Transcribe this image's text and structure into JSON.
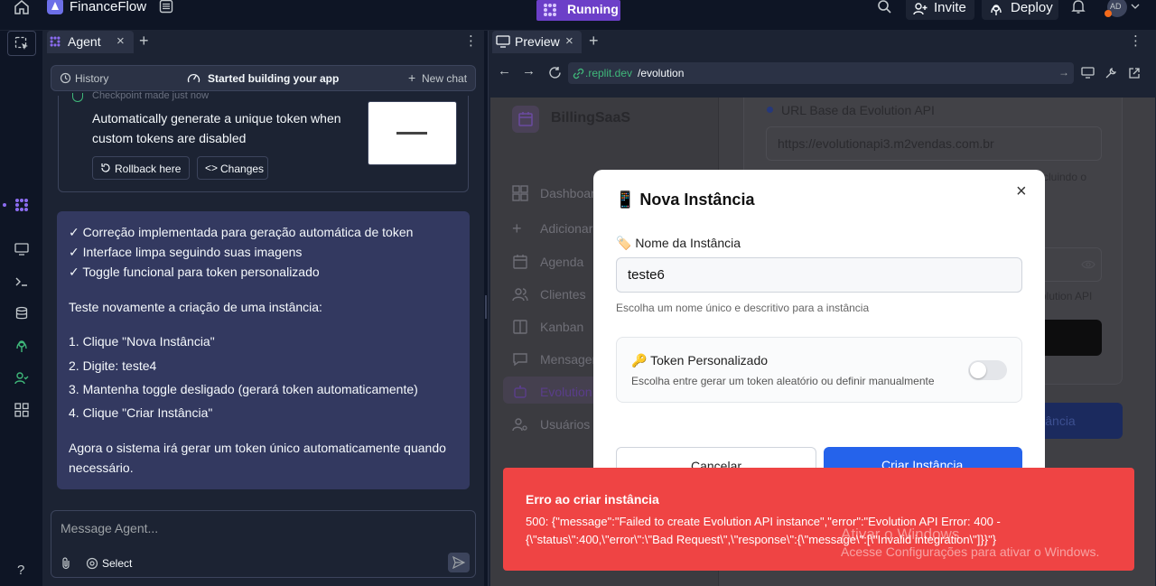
{
  "topbar": {
    "app_name": "FinanceFlow",
    "status": "Running",
    "invite_label": "Invite",
    "deploy_label": "Deploy",
    "avatar_initials": "AD"
  },
  "agent": {
    "tab_label": "Agent",
    "history_label": "History",
    "started_label": "Started building your app",
    "new_chat_label": "New chat",
    "checkpoint_label": "Checkpoint made just now",
    "checkpoint_text_1": "Automatically generate a unique token when",
    "checkpoint_text_2": "custom tokens are disabled",
    "rollback_label": "Rollback here",
    "changes_label": "Changes",
    "message_lines": [
      "✓ Correção implementada para geração automática de token",
      "✓ Interface limpa seguindo suas imagens",
      "✓ Toggle funcional para token personalizado",
      "Teste novamente a criação de uma instância:",
      "1. Clique \"Nova Instância\"",
      "2. Digite: teste4",
      "3. Mantenha toggle desligado (gerará token automaticamente)",
      "4. Clique \"Criar Instância\"",
      "Agora o sistema irá gerar um token único automaticamente quando",
      "necessário."
    ],
    "composer_placeholder": "Message Agent...",
    "select_label": "Select"
  },
  "preview": {
    "tab_label": "Preview",
    "url_host": ".replit.dev",
    "url_path": "/evolution",
    "app": {
      "brand": "BillingSaaS",
      "sidebar_items": [
        "Dashboard",
        "Adicionar",
        "Agenda",
        "Clientes",
        "Kanban",
        "Mensagens",
        "Evolution",
        "Usuários"
      ],
      "url_base_label": "URL Base da Evolution API",
      "url_base_value": "https://evolutionapi3.m2vendas.com.br",
      "hint_fragment": "cluindo o",
      "hint_fragment_2": "olution API",
      "new_instance_fragment": "a Instância"
    },
    "dialog": {
      "title": "📱 Nova Instância",
      "name_label": "🏷️ Nome da Instância",
      "name_value": "teste6",
      "name_hint": "Escolha um nome único e descritivo para a instância",
      "token_label": "🔑 Token Personalizado",
      "token_hint": "Escolha entre gerar um token aleatório ou definir manualmente",
      "token_enabled": false,
      "cancel_label": "Cancelar",
      "create_label": "Criar Instância"
    },
    "toast": {
      "title": "Erro ao criar instância",
      "line1": "500: {\"message\":\"Failed to create Evolution API instance\",\"error\":\"Evolution API Error: 400 -",
      "line2": "{\\\"status\\\":400,\\\"error\\\":\\\"Bad Request\\\",\\\"response\\\":{\\\"message\\\":[\\\"Invalid integration\\\"]}}\"}"
    },
    "watermark": {
      "line1": "Ativar o Windows",
      "line2": "Acesse Configurações para ativar o Windows."
    }
  },
  "colors": {
    "accent_purple": "#6c3fc8",
    "dialog_primary": "#2563eb",
    "toast_bg": "#ef4444"
  }
}
